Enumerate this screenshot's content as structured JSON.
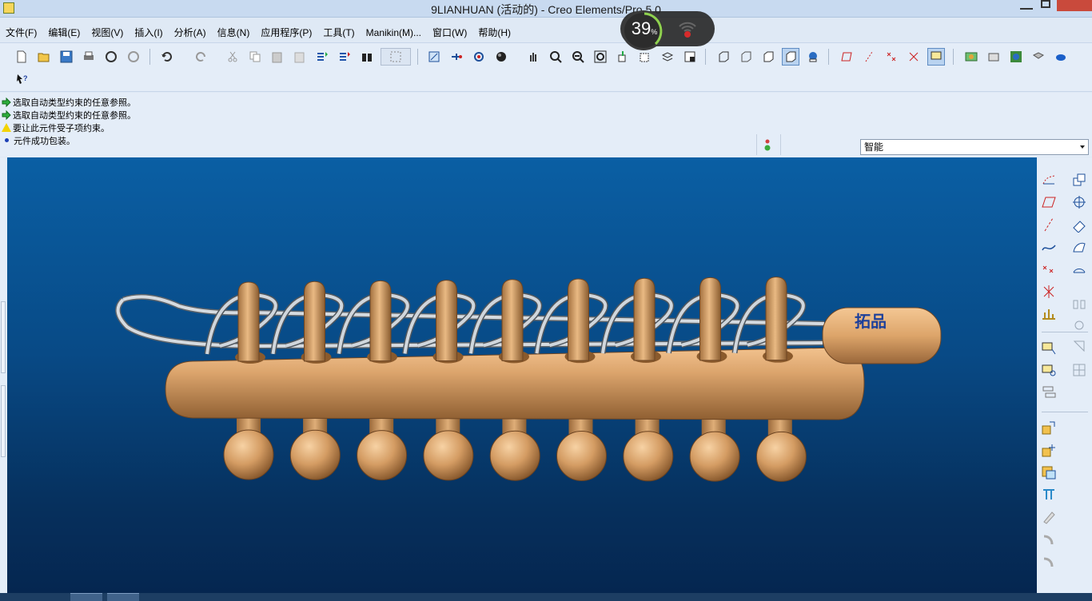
{
  "window": {
    "title": "9LIANHUAN (活动的) - Creo Elements/Pro 5.0"
  },
  "menu": [
    {
      "id": "file",
      "label": "文件(F)"
    },
    {
      "id": "edit",
      "label": "编辑(E)"
    },
    {
      "id": "view",
      "label": "视图(V)"
    },
    {
      "id": "insert",
      "label": "插入(I)"
    },
    {
      "id": "analysis",
      "label": "分析(A)"
    },
    {
      "id": "info",
      "label": "信息(N)"
    },
    {
      "id": "applications",
      "label": "应用程序(P)"
    },
    {
      "id": "tools",
      "label": "工具(T)"
    },
    {
      "id": "manikin",
      "label": "Manikin(M)..."
    },
    {
      "id": "window",
      "label": "窗口(W)"
    },
    {
      "id": "help",
      "label": "帮助(H)"
    }
  ],
  "messages": [
    {
      "type": "prompt",
      "text": "选取自动类型约束的任意参照。"
    },
    {
      "type": "prompt",
      "text": "选取自动类型约束的任意参照。"
    },
    {
      "type": "warning",
      "text": "要让此元件受子项约束。"
    },
    {
      "type": "info",
      "text": "元件成功包装。"
    }
  ],
  "filter": {
    "selected": "智能"
  },
  "model": {
    "label": "拓品",
    "pin_count": 9
  },
  "overlay": {
    "percent": "39",
    "percent_unit": "%"
  },
  "colors": {
    "model": "#d9a26c",
    "wire": "#c8ced4",
    "background_top": "#0a5fa4",
    "background_bottom": "#052650"
  }
}
